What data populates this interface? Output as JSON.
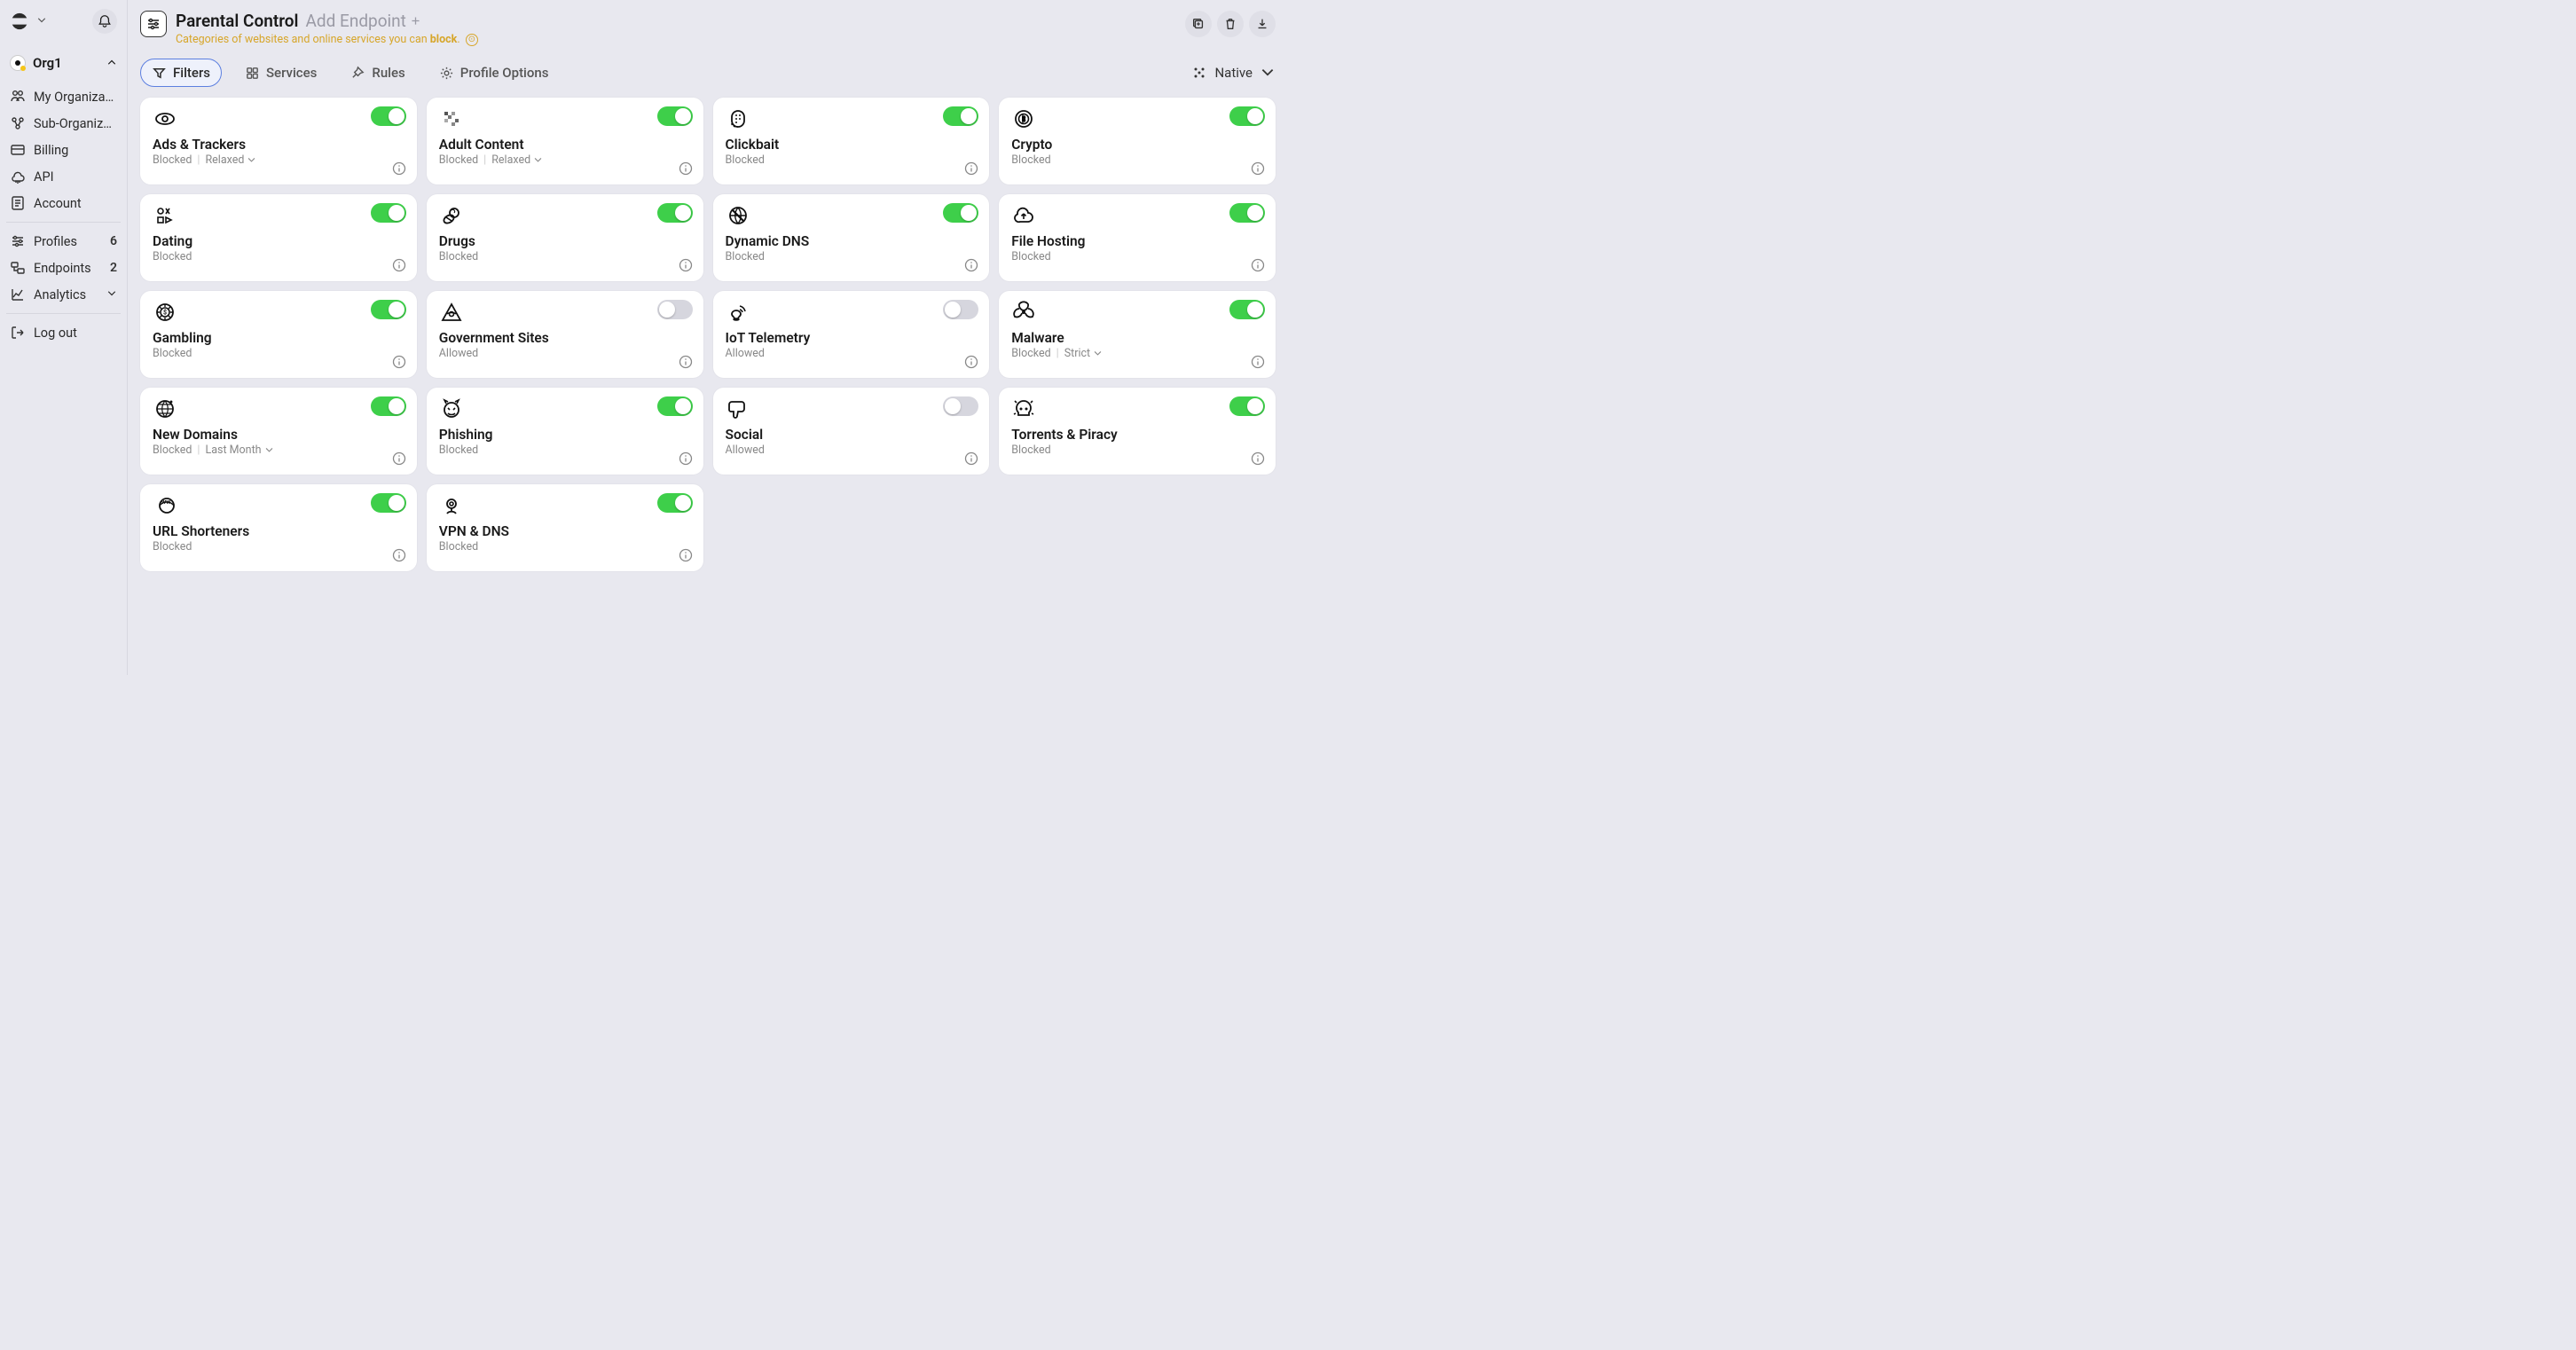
{
  "sidebar": {
    "org_name": "Org1",
    "items_primary": [
      {
        "label": "My Organization",
        "icon": "users"
      },
      {
        "label": "Sub-Organizations",
        "icon": "org"
      },
      {
        "label": "Billing",
        "icon": "card"
      },
      {
        "label": "API",
        "icon": "cloud"
      },
      {
        "label": "Account",
        "icon": "doc"
      }
    ],
    "items_secondary": [
      {
        "label": "Profiles",
        "icon": "sliders",
        "count": "6"
      },
      {
        "label": "Endpoints",
        "icon": "endpoints",
        "count": "2"
      },
      {
        "label": "Analytics",
        "icon": "chart",
        "chevron": true
      }
    ],
    "logout": "Log out"
  },
  "header": {
    "title": "Parental Control",
    "add_endpoint": "Add Endpoint",
    "subtitle_pre": "Categories of websites and online services you can ",
    "subtitle_bold": "block",
    "subtitle_post": "."
  },
  "tabs": [
    {
      "label": "Filters",
      "icon": "funnel",
      "active": true
    },
    {
      "label": "Services",
      "icon": "grid"
    },
    {
      "label": "Rules",
      "icon": "pin"
    },
    {
      "label": "Profile Options",
      "icon": "gear"
    }
  ],
  "view_mode": "Native",
  "filters": [
    {
      "title": "Ads & Trackers",
      "status": "Blocked",
      "mode": "Relaxed",
      "enabled": true,
      "icon": "eye"
    },
    {
      "title": "Adult Content",
      "status": "Blocked",
      "mode": "Relaxed",
      "enabled": true,
      "icon": "pixels"
    },
    {
      "title": "Clickbait",
      "status": "Blocked",
      "enabled": true,
      "icon": "paper"
    },
    {
      "title": "Crypto",
      "status": "Blocked",
      "enabled": true,
      "icon": "coin"
    },
    {
      "title": "Dating",
      "status": "Blocked",
      "enabled": true,
      "icon": "symbols"
    },
    {
      "title": "Drugs",
      "status": "Blocked",
      "enabled": true,
      "icon": "pills"
    },
    {
      "title": "Dynamic DNS",
      "status": "Blocked",
      "enabled": true,
      "icon": "globe-x"
    },
    {
      "title": "File Hosting",
      "status": "Blocked",
      "enabled": true,
      "icon": "cloud-up"
    },
    {
      "title": "Gambling",
      "status": "Blocked",
      "enabled": true,
      "icon": "chip"
    },
    {
      "title": "Government Sites",
      "status": "Allowed",
      "enabled": false,
      "icon": "pyramid"
    },
    {
      "title": "IoT Telemetry",
      "status": "Allowed",
      "enabled": false,
      "icon": "iot"
    },
    {
      "title": "Malware",
      "status": "Blocked",
      "mode": "Strict",
      "enabled": true,
      "icon": "hazard"
    },
    {
      "title": "New Domains",
      "status": "Blocked",
      "mode": "Last Month",
      "enabled": true,
      "icon": "globe-new"
    },
    {
      "title": "Phishing",
      "status": "Blocked",
      "enabled": true,
      "icon": "devil"
    },
    {
      "title": "Social",
      "status": "Allowed",
      "enabled": false,
      "icon": "thumb-down"
    },
    {
      "title": "Torrents & Piracy",
      "status": "Blocked",
      "enabled": true,
      "icon": "skull"
    },
    {
      "title": "URL Shorteners",
      "status": "Blocked",
      "enabled": true,
      "icon": "www"
    },
    {
      "title": "VPN & DNS",
      "status": "Blocked",
      "enabled": true,
      "icon": "vpn"
    }
  ]
}
